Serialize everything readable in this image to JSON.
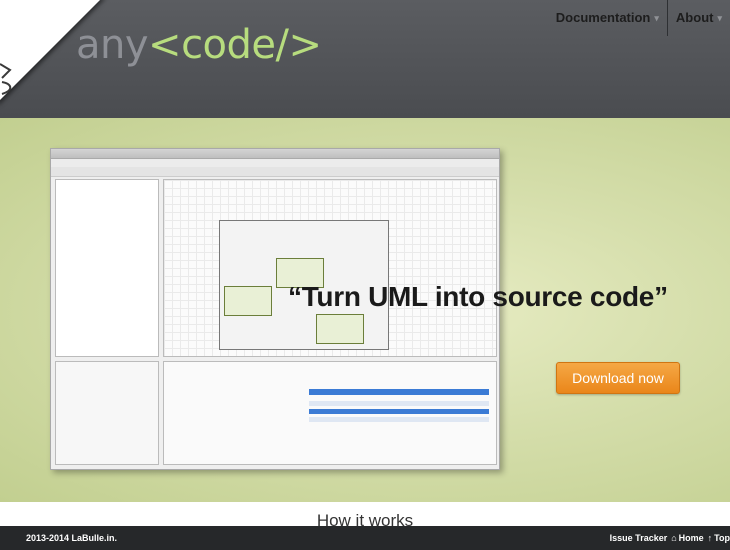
{
  "header": {
    "logo_prefix": "any",
    "logo_code": "<code/>",
    "nav": [
      {
        "label": "Documentation",
        "icon": "caret-down-icon"
      },
      {
        "label": "About",
        "icon": "caret-down-icon"
      }
    ]
  },
  "hero": {
    "tagline": "“Turn UML into source code”",
    "download_label": "Download now"
  },
  "section": {
    "title": "How it works"
  },
  "footer": {
    "copyright": "2013-2014 LaBulle.in.",
    "links": [
      {
        "label": "Issue Tracker"
      },
      {
        "label": "Home",
        "icon": "home-icon"
      },
      {
        "label": "Top",
        "icon": "arrow-up-icon"
      }
    ]
  },
  "colors": {
    "header_bg": "#4f5155",
    "logo_accent": "#b7dc7e",
    "button": "#ee9220",
    "footer_bg": "#26282a"
  }
}
